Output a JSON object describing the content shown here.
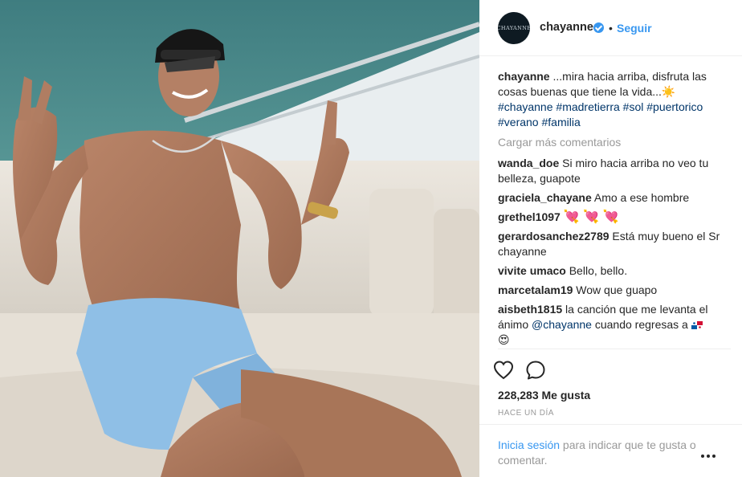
{
  "post": {
    "author": {
      "username": "chayanne",
      "avatar_text": "CHAYANNE",
      "follow_label": "Seguir",
      "separator": "•"
    },
    "caption": {
      "username": "chayanne",
      "text": " ...mira hacia arriba, disfruta las cosas buenas que tiene la vida...",
      "emoji": "☀️",
      "hashtags": [
        "#chayanne",
        "#madretierra",
        "#sol",
        "#puertorico",
        "#verano",
        "#familia"
      ]
    },
    "load_more_label": "Cargar más comentarios",
    "comments": [
      {
        "username": "wanda_doe",
        "text": " Si miro hacia arriba no veo tu belleza, guapote"
      },
      {
        "username": "graciela_chayane",
        "text": " Amo a ese hombre"
      },
      {
        "username": "grethel1097",
        "text": " ",
        "emoji": "💘 💘 💘"
      },
      {
        "username": "gerardosanchez2789",
        "text": " Está muy bueno el Sr chayanne"
      },
      {
        "username": "vivite umaco",
        "text": " Bello, bello."
      },
      {
        "username": "marcetalam19",
        "text": " Wow que guapo"
      },
      {
        "username": "aisbeth1815",
        "text": " la canción que me levanta el ánimo ",
        "mention": "@chayanne",
        "text_after": " cuando regresas a ",
        "emoji_end": "😍"
      }
    ],
    "likes_label": "228,283 Me gusta",
    "timestamp": "HACE UN DÍA",
    "login_prompt": {
      "link": "Inicia sesión",
      "text": " para indicar que te gusta o comentar."
    },
    "icons": {
      "like": "heart-outline-icon",
      "comment": "speech-bubble-icon",
      "more": "ellipsis-icon",
      "verified": "verified-badge-icon"
    },
    "colors": {
      "accent": "#3897f0",
      "link": "#003569",
      "muted": "#999999"
    }
  }
}
